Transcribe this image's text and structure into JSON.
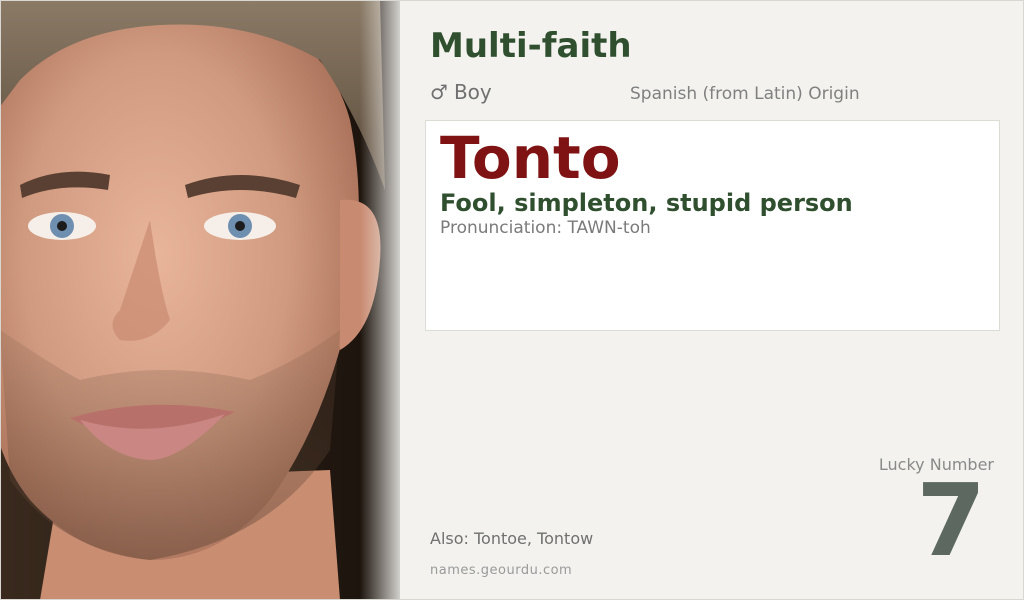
{
  "category": "Multi-faith",
  "gender": {
    "icon": "male-symbol-icon",
    "symbol": "♂",
    "label": "Boy"
  },
  "origin": "Spanish (from Latin) Origin",
  "name": {
    "title": "Tonto",
    "meaning": "Fool, simpleton, stupid person",
    "pronunciation": "Pronunciation: TAWN-toh"
  },
  "lucky": {
    "label": "Lucky Number",
    "number": "7"
  },
  "also": "Also: Tontoe, Tontow",
  "source": "names.geourdu.com",
  "colors": {
    "background": "#f3f2ee",
    "category": "#2f4f2f",
    "name": "#7f1313",
    "meaning": "#2f4f2f",
    "lucky_number": "#5c6860"
  }
}
